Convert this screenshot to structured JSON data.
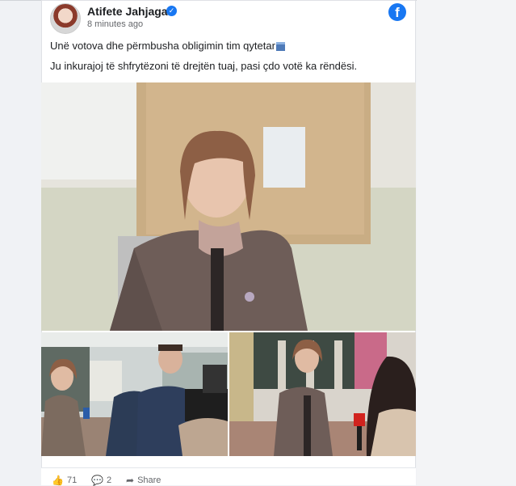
{
  "post": {
    "author": "Atifete Jahjaga",
    "timestamp": "8 minutes ago",
    "text_line1": "Unë votova dhe përmbusha obligimin tim qytetar",
    "text_line2": "Ju inkurajoj të shfrytëzoni të drejtën tuaj, pasi çdo votë ka rëndësi."
  },
  "icons": {
    "verified": "verified-badge-icon",
    "platform": "facebook-icon",
    "ballot": "ballot-box-icon",
    "like": "thumbs-up-icon",
    "comment": "comment-icon",
    "share": "share-icon"
  },
  "engagement": {
    "likes": "71",
    "comments": "2",
    "share_label": "Share"
  },
  "colors": {
    "brand": "#1877f2"
  }
}
